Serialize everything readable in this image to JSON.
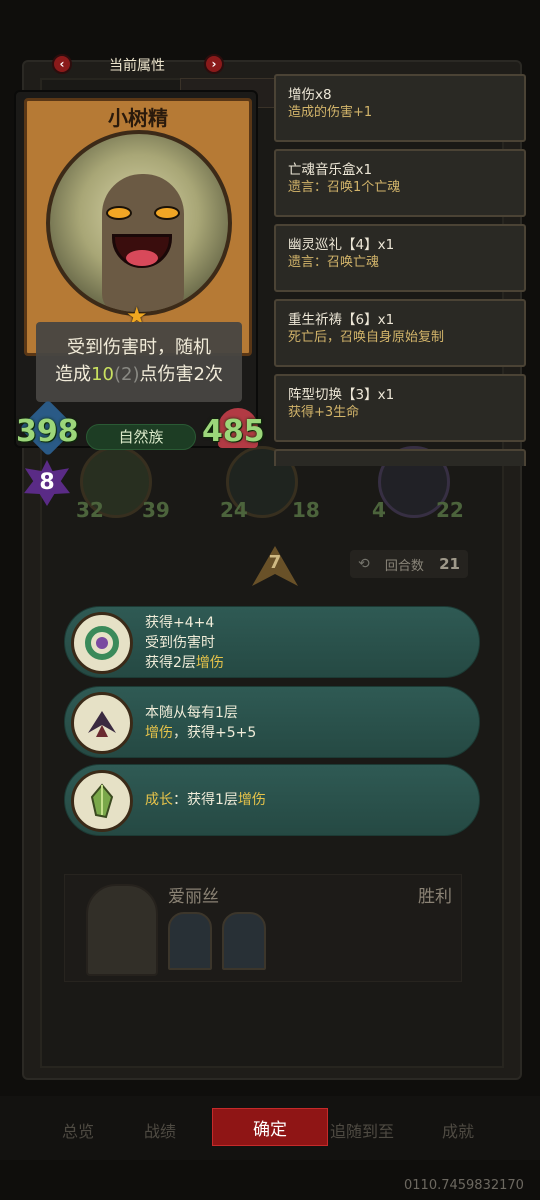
{
  "header": {
    "title": "当前属性",
    "prev_label": "‹",
    "next_label": "›"
  },
  "card": {
    "name": "小树精",
    "description_part1": "受到伤害时，随机",
    "description_part2a": "造成",
    "description_value": "10",
    "description_paren": "(2)",
    "description_part2b": "点伤害2次",
    "attack": "398",
    "health": "485",
    "race": "自然族",
    "tier": "8"
  },
  "effects": [
    {
      "title": "增伤x8",
      "detail": "造成的伤害+1"
    },
    {
      "title": "亡魂音乐盒x1",
      "detail": "遗言：召唤1个亡魂"
    },
    {
      "title": "幽灵巡礼【4】x1",
      "detail": "遗言：召唤亡魂"
    },
    {
      "title": "重生祈祷【6】x1",
      "detail": "死亡后，召唤自身原始复制"
    },
    {
      "title": "阵型切换【3】x1",
      "detail": "获得+3生命"
    }
  ],
  "board_units": [
    {
      "atk": "32",
      "hp": "39"
    },
    {
      "atk": "24",
      "hp": "18"
    },
    {
      "atk": "4",
      "hp": "22"
    }
  ],
  "gold": "7",
  "round": {
    "label": "回合数",
    "value": "21"
  },
  "buffs": [
    {
      "line1": "获得+4+4",
      "line2": "受到伤害时",
      "line3a": "获得2层",
      "line3b": "增伤"
    },
    {
      "line1": "本随从每有1层",
      "line2a": "增伤",
      "line2b": "，获得+5+5"
    },
    {
      "line1a": "成长",
      "line1b": "：获得1层",
      "line1c": "增伤"
    }
  ],
  "player": {
    "name": "爱丽丝",
    "result": "胜利"
  },
  "bottom_nav": {
    "tab1": "总览",
    "tab2": "战绩",
    "confirm": "确定",
    "tab4": "追随到至",
    "tab5": "成就"
  },
  "uid": "0110.7459832170"
}
